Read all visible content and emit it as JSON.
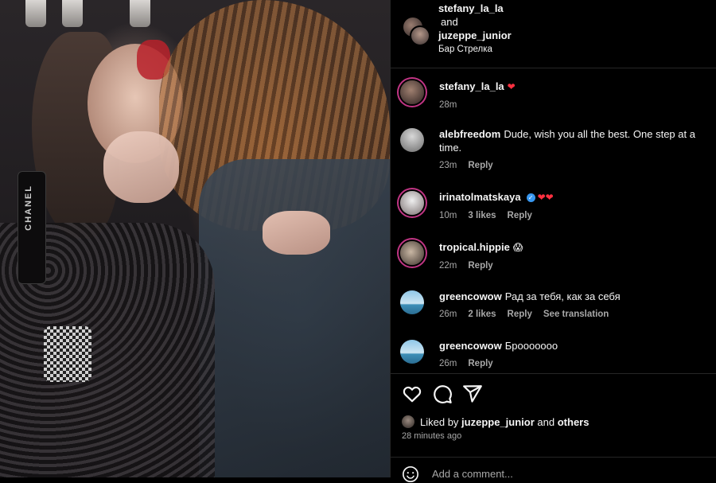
{
  "header": {
    "user1": "stefany_la_la",
    "and": "and",
    "user2": "juzeppe_junior",
    "location": "Бар Стрелка"
  },
  "photo": {
    "strap_text": "CHANEL"
  },
  "comments": [
    {
      "user": "stefany_la_la",
      "text": "",
      "emoji": "❤",
      "time": "28m",
      "likes": "",
      "reply": "",
      "translate": ""
    },
    {
      "user": "alebfreedom",
      "text": "Dude, wish you all the best. One step at a time.",
      "time": "23m",
      "likes": "",
      "reply": "Reply",
      "translate": ""
    },
    {
      "user": "irinatolmatskaya",
      "text": "",
      "emoji": "❤❤",
      "time": "10m",
      "likes": "3 likes",
      "reply": "Reply",
      "translate": ""
    },
    {
      "user": "tropical.hippie",
      "text": "",
      "emoji": "😱",
      "time": "22m",
      "likes": "",
      "reply": "Reply",
      "translate": ""
    },
    {
      "user": "greencowow",
      "text": "Рад за тебя, как за себя",
      "time": "26m",
      "likes": "2 likes",
      "reply": "Reply",
      "translate": "See translation"
    },
    {
      "user": "greencowow",
      "text": "Броооoooo",
      "time": "26m",
      "likes": "",
      "reply": "Reply",
      "translate": ""
    }
  ],
  "actions": {
    "icons": [
      "heart-icon",
      "comment-icon",
      "share-icon"
    ],
    "liked_prefix": "Liked by",
    "liked_user": "juzeppe_junior",
    "liked_and": "and",
    "liked_others": "others",
    "time_ago": "28 minutes ago",
    "add_comment_placeholder": "Add a comment..."
  },
  "colors": {
    "background": "#000000",
    "text": "#f5f5f5",
    "secondary_text": "#a8a8a8",
    "story_ring": "#c13584",
    "verified": "#3897f0",
    "heart": "#ff3040"
  }
}
